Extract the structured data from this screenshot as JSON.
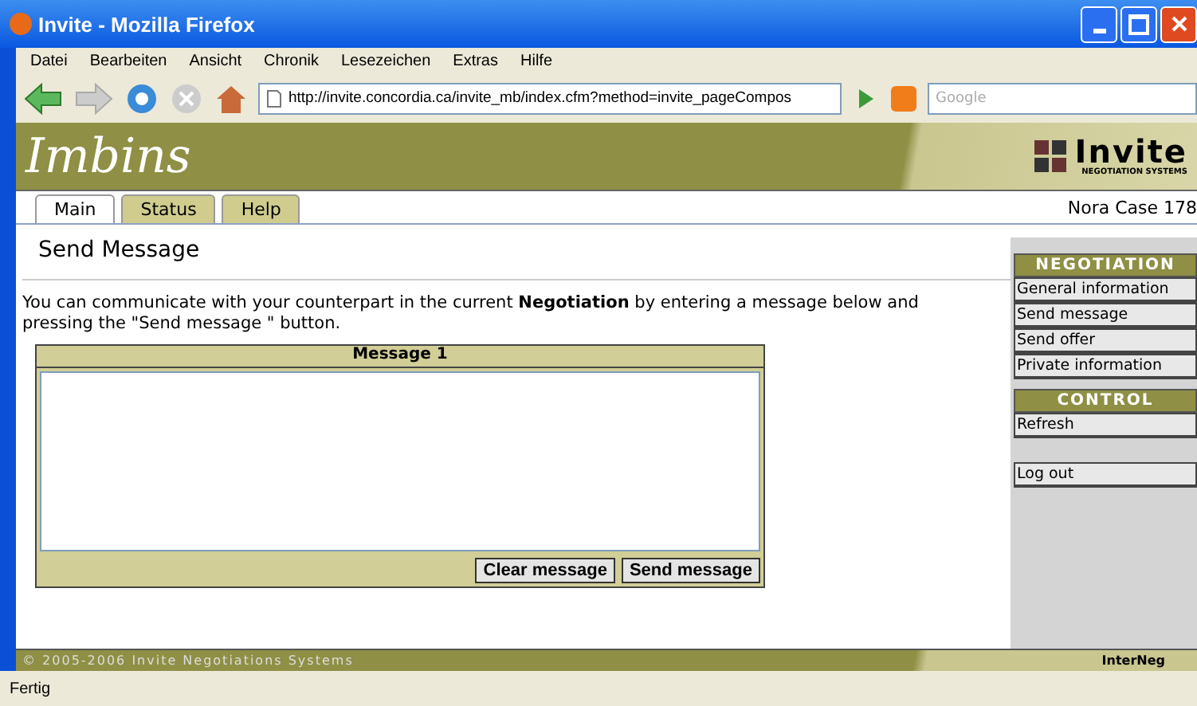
{
  "window": {
    "title": "Invite - Mozilla Firefox"
  },
  "menu": [
    "Datei",
    "Bearbeiten",
    "Ansicht",
    "Chronik",
    "Lesezeichen",
    "Extras",
    "Hilfe"
  ],
  "address": {
    "value": "http://invite.concordia.ca/invite_mb/index.cfm?method=invite_pageCompos"
  },
  "search": {
    "placeholder": "Google"
  },
  "banner": {
    "title": "Imbins",
    "logo": "Invite",
    "logo_sub": "NEGOTIATION SYSTEMS"
  },
  "tabs": [
    {
      "label": "Main",
      "selected": true
    },
    {
      "label": "Status",
      "selected": false
    },
    {
      "label": "Help",
      "selected": false
    }
  ],
  "case_label": "Nora Case 178",
  "heading": "Send Message",
  "intro": "You can communicate with your counterpart in the current **Negotiation** by entering a message below and pressing the \"Send message \" button.",
  "message": {
    "title": "Message 1",
    "buttons": [
      "Clear message",
      "Send message"
    ]
  },
  "sidebar": [
    {
      "title": "NEGOTIATION",
      "items": [
        "General information",
        "Send message",
        "Send offer",
        "Private information"
      ]
    },
    {
      "title": "CONTROL",
      "items": [
        "Refresh"
      ],
      "bottom_items": [
        "Log out"
      ]
    }
  ],
  "footer": {
    "copyright": "© 2005-2006 Invite Negotiations Systems",
    "brand": "InterNeg"
  },
  "status_bar": "Fertig"
}
